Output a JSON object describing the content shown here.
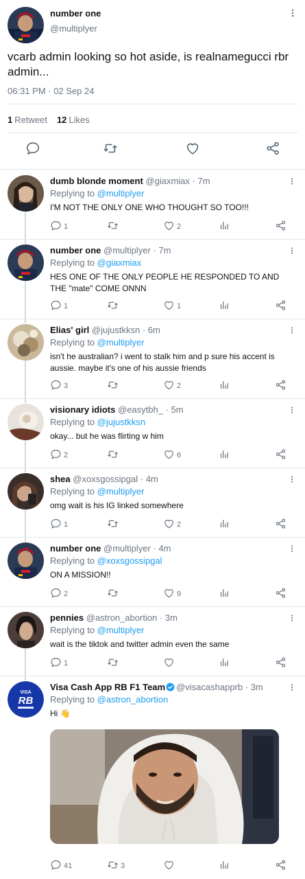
{
  "main_tweet": {
    "name": "number one",
    "handle": "@multiplyer",
    "text": "vcarb admin looking so hot aside, is realnamegucci rbr admin...",
    "timestamp": "06:31 PM · 02 Sep 24",
    "retweets_count": "1",
    "retweets_label": "Retweet",
    "likes_count": "12",
    "likes_label": "Likes"
  },
  "replies": [
    {
      "name": "dumb blonde moment",
      "handle": "@giaxmiax",
      "time": "· 7m",
      "replying_label": "Replying to",
      "replying_to": "@multiplyer",
      "text": "I'M NOT THE ONLY ONE WHO THOUGHT SO TOO!!!",
      "reply_count": "1",
      "retweet_count": "",
      "like_count": "2"
    },
    {
      "name": "number one",
      "handle": "@multiplyer",
      "time": "· 7m",
      "replying_label": "Replying to",
      "replying_to": "@giaxmiax",
      "text": "HES ONE OF THE ONLY PEOPLE HE RESPONDED TO AND THE \"mate\" COME ONNN",
      "reply_count": "1",
      "retweet_count": "",
      "like_count": "1"
    },
    {
      "name": "Elias' girl",
      "handle": "@jujustkksn",
      "time": "· 6m",
      "replying_label": "Replying to",
      "replying_to": "@multiplyer",
      "text": "isn't he australian? i went to stalk him and p sure his accent is aussie. maybe it's one of his aussie friends",
      "reply_count": "3",
      "retweet_count": "",
      "like_count": "2"
    },
    {
      "name": "visionary idiots",
      "handle": "@easytbh_",
      "time": "· 5m",
      "replying_label": "Replying to",
      "replying_to": "@jujustkksn",
      "text": "okay... but he was flirting w him",
      "reply_count": "2",
      "retweet_count": "",
      "like_count": "6"
    },
    {
      "name": "shea",
      "handle": "@xoxsgossipgal",
      "time": "· 4m",
      "replying_label": "Replying to",
      "replying_to": "@multiplyer",
      "text": "omg wait is his IG linked somewhere",
      "reply_count": "1",
      "retweet_count": "",
      "like_count": "2"
    },
    {
      "name": "number one",
      "handle": "@multiplyer",
      "time": "· 4m",
      "replying_label": "Replying to",
      "replying_to": "@xoxsgossipgal",
      "text": "ON A MISSION!!",
      "reply_count": "2",
      "retweet_count": "",
      "like_count": "9"
    },
    {
      "name": "pennies",
      "handle": "@astron_abortion",
      "time": "· 3m",
      "replying_label": "Replying to",
      "replying_to": "@multiplyer",
      "text": "wait is the tiktok and twitter admin even the same",
      "reply_count": "1",
      "retweet_count": "",
      "like_count": ""
    },
    {
      "name": "Visa Cash App RB F1 Team",
      "handle": "@visacashapprb",
      "time": "· 3m",
      "replying_label": "Replying to",
      "replying_to": "@astron_abortion",
      "text": "Hi 👋",
      "reply_count": "41",
      "retweet_count": "3",
      "like_count": "",
      "verified": true,
      "avatar_text_top": "VISA",
      "avatar_text_mid": "RB"
    }
  ],
  "icons": {
    "reply": "reply-icon",
    "retweet": "retweet-icon",
    "like": "heart-icon",
    "stats": "stats-icon",
    "share": "share-icon",
    "more": "more-vertical-icon",
    "verified": "verified-badge-icon"
  },
  "colors": {
    "accent": "#1d9bf0",
    "text": "#0f1419",
    "secondary": "#6b7580",
    "divider": "#e1e6ea",
    "verified": "#1d9bf0"
  }
}
